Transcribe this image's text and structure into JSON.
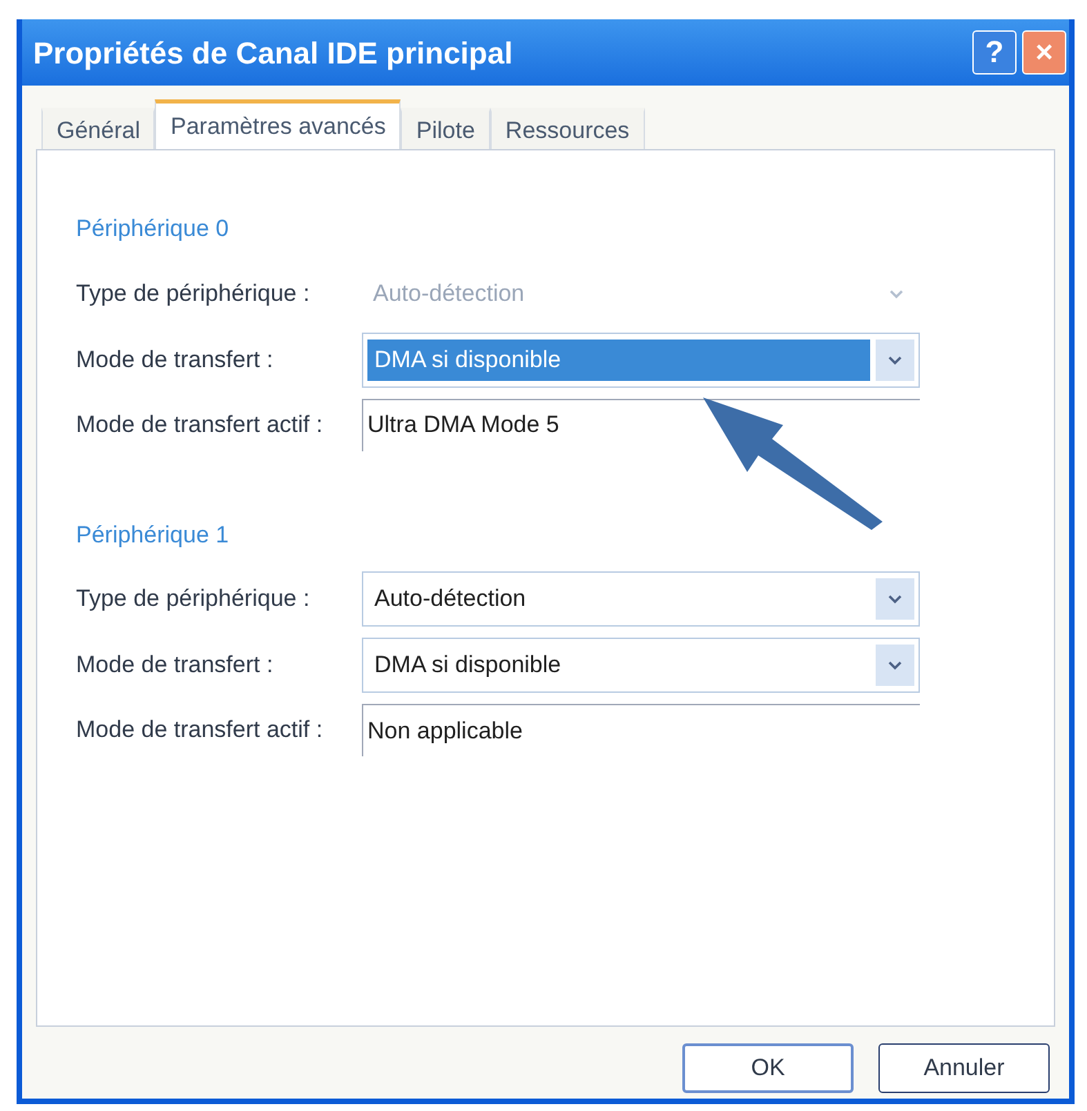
{
  "window": {
    "title": "Propriétés de Canal IDE principal"
  },
  "title_buttons": [
    {
      "kind": "help",
      "label": "?"
    },
    {
      "kind": "close",
      "label": "×"
    }
  ],
  "tabs": [
    {
      "label": "Général",
      "selected": false
    },
    {
      "label": "Paramètres avancés",
      "selected": true
    },
    {
      "label": "Pilote",
      "selected": false
    },
    {
      "label": "Ressources",
      "selected": false
    }
  ],
  "devices": [
    {
      "title": "Périphérique 0",
      "rows": [
        {
          "kind": "combo",
          "label": "Type de périphérique :",
          "value": "Auto-détection",
          "disabled": true,
          "highlighted": false
        },
        {
          "kind": "combo",
          "label": "Mode de transfert :",
          "value": "DMA si disponible",
          "disabled": false,
          "highlighted": true
        },
        {
          "kind": "field",
          "label": "Mode de transfert actif :",
          "value": "Ultra DMA Mode 5"
        }
      ]
    },
    {
      "title": "Périphérique 1",
      "rows": [
        {
          "kind": "combo",
          "label": "Type de périphérique :",
          "value": "Auto-détection",
          "disabled": false,
          "highlighted": false
        },
        {
          "kind": "combo",
          "label": "Mode de transfert :",
          "value": "DMA si disponible",
          "disabled": false,
          "highlighted": false
        },
        {
          "kind": "field",
          "label": "Mode de transfert actif :",
          "value": "Non applicable"
        }
      ]
    }
  ],
  "buttons": [
    {
      "label": "OK",
      "default": true
    },
    {
      "label": "Annuler",
      "default": false
    }
  ]
}
